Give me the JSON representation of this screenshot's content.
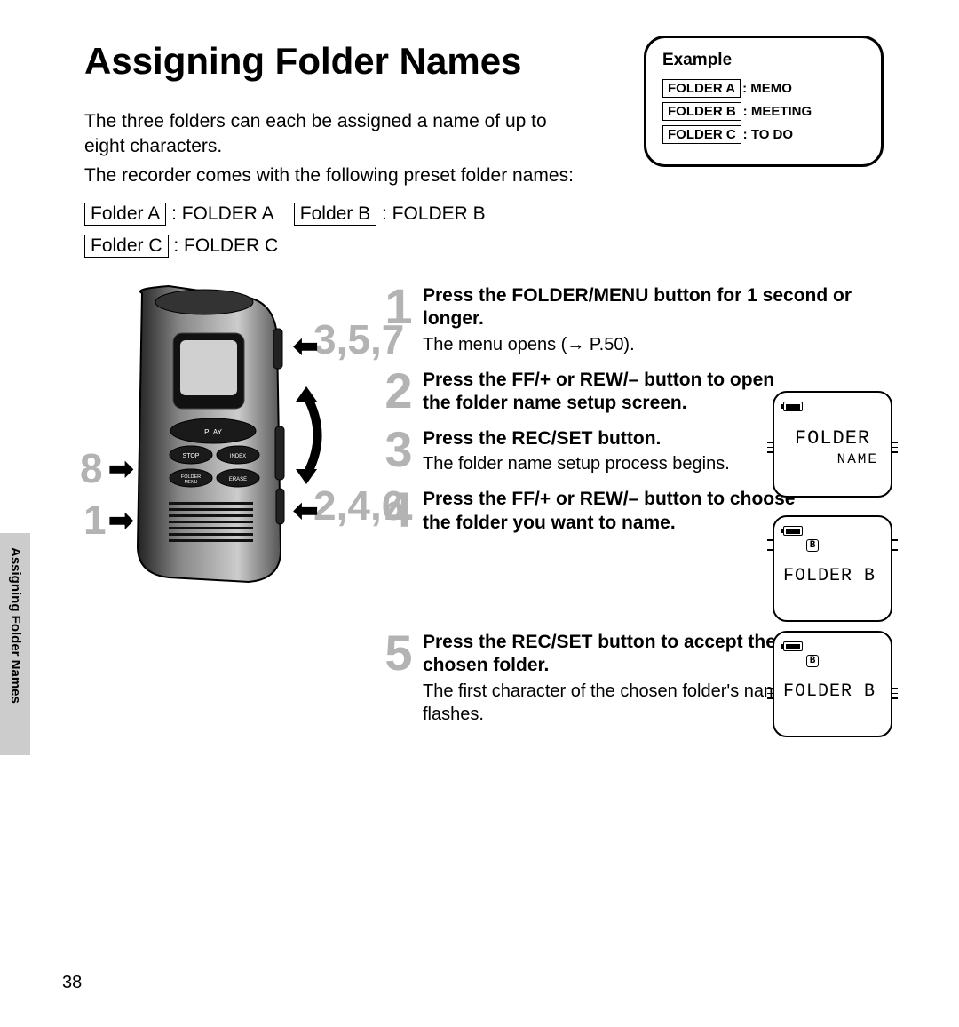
{
  "title": "Assigning Folder Names",
  "side_tab": "Assigning Folder Names",
  "page_number": "38",
  "intro": {
    "p1": "The three folders can each be assigned a name of up to eight characters.",
    "p2": "The recorder comes with the following preset folder names:"
  },
  "presets": {
    "a_tag": "Folder A",
    "a_val": ": FOLDER A",
    "b_tag": "Folder B",
    "b_val": ": FOLDER B",
    "c_tag": "Folder C",
    "c_val": ": FOLDER C"
  },
  "example": {
    "title": "Example",
    "rows": [
      {
        "tag": "FOLDER A",
        "val": ": MEMO"
      },
      {
        "tag": "FOLDER B",
        "val": ": MEETING"
      },
      {
        "tag": "FOLDER C",
        "val": ": TO DO"
      }
    ]
  },
  "callouts": {
    "n8": "8",
    "n1": "1",
    "n357": "3,5,7",
    "n246": "2,4,6"
  },
  "steps": [
    {
      "num": "1",
      "title": "Press the FOLDER/MENU button for 1 second or longer.",
      "desc": "The menu opens (→ P.50)."
    },
    {
      "num": "2",
      "title": "Press the FF/+ or REW/– button to open the folder name setup screen.",
      "desc": ""
    },
    {
      "num": "3",
      "title": "Press the REC/SET button.",
      "desc": "The folder name setup process begins."
    },
    {
      "num": "4",
      "title": "Press the FF/+ or REW/– button to choose the folder you want to name.",
      "desc": ""
    },
    {
      "num": "5",
      "title": "Press the REC/SET button to accept the chosen folder.",
      "desc": "The first character of the chosen folder's name flashes."
    }
  ],
  "lcd": {
    "screen1_line1": "FOLDER",
    "screen1_line2": "NAME",
    "b_letter": "B",
    "screen2_text": "FOLDER B",
    "screen3_text": "FOLDER B"
  },
  "device_labels": {
    "play": "PLAY",
    "stop": "STOP",
    "index": "INDEX",
    "folder": "FOLDER",
    "menu": "MENU",
    "erase": "ERASE"
  }
}
